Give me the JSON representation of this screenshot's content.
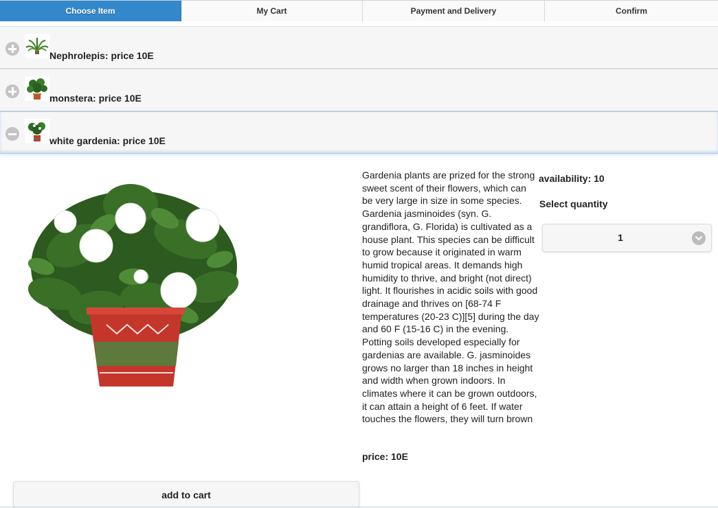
{
  "tabs": [
    {
      "label": "Choose Item",
      "active": true
    },
    {
      "label": "My Cart",
      "active": false
    },
    {
      "label": "Payment and Delivery",
      "active": false
    },
    {
      "label": "Confirm",
      "active": false
    }
  ],
  "items": [
    {
      "title": "Nephrolepis: price 10E",
      "state": "collapsed",
      "icon": "plus-icon"
    },
    {
      "title": "monstera: price 10E",
      "state": "collapsed",
      "icon": "plus-icon"
    },
    {
      "title": "white gardenia: price 10E",
      "state": "expanded",
      "icon": "minus-icon"
    }
  ],
  "detail": {
    "description": "Gardenia plants are prized for the strong sweet scent of their flowers, which can be very large in size in some species. Gardenia jasminoides (syn. G. grandiflora, G. Florida) is cultivated as a house plant. This species can be difficult to grow because it originated in warm humid tropical areas. It demands high humidity to thrive, and bright (not direct) light. It flourishes in acidic soils with good drainage and thrives on [68-74 F temperatures (20-23 C)][5] during the day and 60 F (15-16 C) in the evening. Potting soils developed especially for gardenias are available. G. jasminoides grows no larger than 18 inches in height and width when grown indoors. In climates where it can be grown outdoors, it can attain a height of 6 feet. If water touches the flowers, they will turn brown",
    "price": "price: 10E",
    "availability": "availability: 10",
    "select_label": "Select quantity",
    "quantity_value": "1",
    "add_to_cart_label": "add to cart"
  },
  "colors": {
    "accent": "#3388cc",
    "row_bg": "#f6f6f6",
    "icon_gray": "#c4c4c4"
  }
}
